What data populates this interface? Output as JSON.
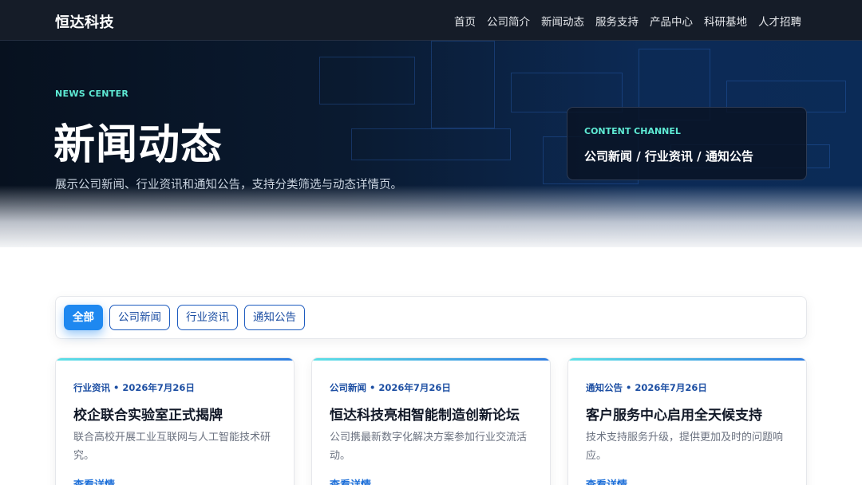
{
  "header": {
    "brand": "恒达科技",
    "nav": [
      "首页",
      "公司简介",
      "新闻动态",
      "服务支持",
      "产品中心",
      "科研基地",
      "人才招聘"
    ]
  },
  "hero": {
    "kicker": "NEWS CENTER",
    "title": "新闻动态",
    "description": "展示公司新闻、行业资讯和通知公告，支持分类筛选与动态详情页。",
    "channel": {
      "kicker": "CONTENT CHANNEL",
      "text": "公司新闻 / 行业资讯 / 通知公告"
    }
  },
  "filters": {
    "items": [
      "全部",
      "公司新闻",
      "行业资讯",
      "通知公告"
    ],
    "active": "全部"
  },
  "cards": [
    {
      "category": "行业资讯",
      "date": "2026年7月26日",
      "meta": "行业资讯 • 2026年7月26日",
      "title": "校企联合实验室正式揭牌",
      "description": "联合高校开展工业互联网与人工智能技术研究。",
      "link": "查看详情"
    },
    {
      "category": "公司新闻",
      "date": "2026年7月26日",
      "meta": "公司新闻 • 2026年7月26日",
      "title": "恒达科技亮相智能制造创新论坛",
      "description": "公司携最新数字化解决方案参加行业交流活动。",
      "link": "查看详情"
    },
    {
      "category": "通知公告",
      "date": "2026年7月26日",
      "meta": "通知公告 • 2026年7月26日",
      "title": "客户服务中心启用全天候支持",
      "description": "技术支持服务升级，提供更加及时的问题响应。",
      "link": "查看详情"
    }
  ],
  "colors": {
    "header_bg": "#151c28",
    "accent": "#1e88f0",
    "kicker": "#5eead4",
    "link": "#1d6fd8"
  }
}
